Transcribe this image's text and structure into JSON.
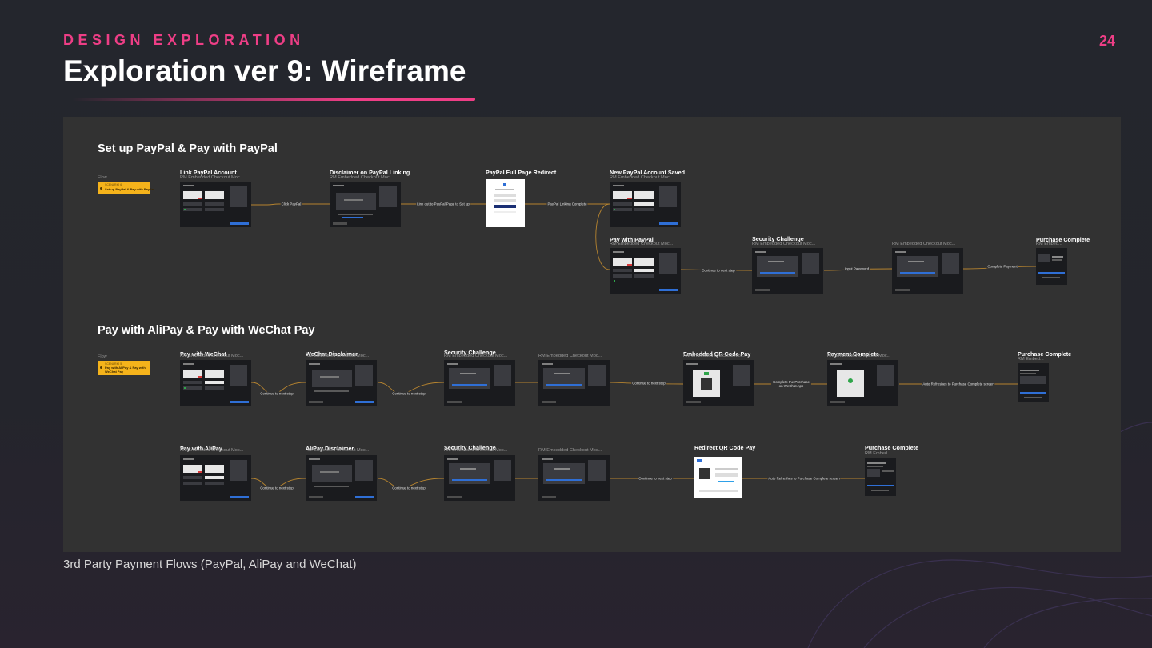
{
  "header": {
    "eyebrow": "DESIGN EXPLORATION",
    "title": "Exploration ver 9: Wireframe",
    "page_number": "24"
  },
  "caption": "3rd Party Payment Flows (PayPal, AliPay and WeChat)",
  "colors": {
    "accent": "#ee3e86",
    "flow_tag": "#f5b31b",
    "canvas": "#323232",
    "connector": "#b5832f"
  },
  "sections": {
    "paypal": {
      "title": "Set up PayPal & Pay with PayPal",
      "flow_label": "Flow",
      "tag_line1": "SCENARIO 6",
      "tag_line2": "Set up PayPal & Pay with PayPal"
    },
    "alipay": {
      "title": "Pay with AliPay & Pay with WeChat Pay",
      "flow_label": "Flow",
      "tag_line1": "SCENARIO 5",
      "tag_line2": "Pay with AliPay & Pay with WeChat Pay"
    }
  },
  "steps": {
    "pp1": {
      "title": "Link PayPal Account",
      "sub": "RM Embedded Checkout Moc..."
    },
    "pp2": {
      "title": "Disclaimer on PayPal Linking",
      "sub": "RM Embedded Checkout Moc..."
    },
    "pp3": {
      "title": "PayPal Full Page Redirect",
      "sub": ""
    },
    "pp4": {
      "title": "New PayPal Account Saved",
      "sub": "RM Embedded Checkout Moc..."
    },
    "pp5": {
      "title": "Pay with PayPal",
      "sub": "RM Embedded Checkout Moc..."
    },
    "pp6": {
      "title": "Security Challenge",
      "sub": "RM Embedded Checkout Moc..."
    },
    "pp7": {
      "title": "",
      "sub": "RM Embedded Checkout Moc..."
    },
    "pp8": {
      "title": "Purchase Complete",
      "sub": "RM Embed..."
    },
    "wc1": {
      "title": "Pay with WeChat",
      "sub": "RM Embedded Checkout Moc..."
    },
    "wc2": {
      "title": "WeChat Disclaimer",
      "sub": "RM Embedded Checkout Moc..."
    },
    "wc3": {
      "title": "Security Challenge",
      "sub": "RM Embedded Checkout Moc..."
    },
    "wc4": {
      "title": "",
      "sub": "RM Embedded Checkout Moc..."
    },
    "wc5": {
      "title": "Embedded QR Code Pay",
      "sub": "RM Embedded Checkout Moc..."
    },
    "wc6": {
      "title": "Payment Complete",
      "sub": "RM Embedded Checkout Moc..."
    },
    "wc7": {
      "title": "Purchase Complete",
      "sub": "RM Embed..."
    },
    "ap1": {
      "title": "Pay with AliPay",
      "sub": "RM Embedded Checkout Moc..."
    },
    "ap2": {
      "title": "AliPay Disclaimer",
      "sub": "RM Embedded Checkout Moc..."
    },
    "ap3": {
      "title": "Security Challenge",
      "sub": "RM Embedded Checkout Moc..."
    },
    "ap4": {
      "title": "",
      "sub": "RM Embedded Checkout Moc..."
    },
    "ap5": {
      "title": "Redirect QR Code Pay",
      "sub": ""
    },
    "ap6": {
      "title": "Purchase Complete",
      "sub": "RM Embed..."
    }
  },
  "edges": {
    "click_paypal": "Click PayPal",
    "link_out": "Link out to PayPal Page to Set up",
    "linking_complete": "PayPal Linking Complete",
    "continue_1": "Continue to next step",
    "input_password": "Input Password",
    "complete_payment": "Complete Payment",
    "continue_wc1": "Continue to next step",
    "continue_wc2": "Continue to next step",
    "continue_wc3": "Continue to next step",
    "complete_wechat": "Complete the Purchase on WeChat App",
    "auto_refresh_wc": "Auto Refreshes to Purchase Complete screen",
    "continue_ap1": "Continue to next step",
    "continue_ap2": "Continue to next step",
    "continue_ap3": "Continue to next step",
    "auto_refresh_ap": "Auto Refreshes to Purchase Complete screen"
  }
}
